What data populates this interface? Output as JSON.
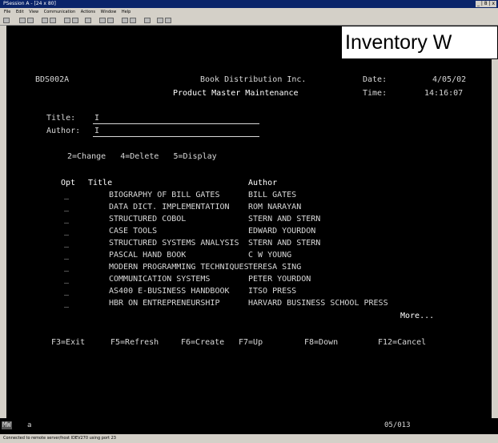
{
  "window": {
    "title": "PSession A - [24 x 80]",
    "controls": "_ | 8 | x"
  },
  "menu": [
    "File",
    "Edit",
    "View",
    "Communication",
    "Actions",
    "Window",
    "Help"
  ],
  "overlay_title": "Inventory W",
  "header": {
    "program_id": "BDS002A",
    "company": "Book Distribution Inc.",
    "screen_title": "Product Master Maintenance",
    "date_label": "Date:",
    "date_value": "4/05/02",
    "time_label": "Time:",
    "time_value": "14:16:07"
  },
  "search": {
    "title_label": "Title:",
    "title_value": "I",
    "author_label": "Author:",
    "author_value": "I"
  },
  "options_line": "2=Change   4=Delete   5=Display",
  "columns": {
    "opt": "Opt",
    "title": "Title",
    "author": "Author"
  },
  "rows": [
    {
      "opt": "_",
      "title": "BIOGRAPHY OF BILL GATES",
      "author": "BILL GATES"
    },
    {
      "opt": "_",
      "title": "DATA DICT. IMPLEMENTATION",
      "author": "ROM NARAYAN"
    },
    {
      "opt": "_",
      "title": "STRUCTURED COBOL",
      "author": "STERN AND STERN"
    },
    {
      "opt": "_",
      "title": "CASE TOOLS",
      "author": "EDWARD YOURDON"
    },
    {
      "opt": "_",
      "title": "STRUCTURED SYSTEMS ANALYSIS",
      "author": "STERN AND STERN"
    },
    {
      "opt": "_",
      "title": "PASCAL HAND BOOK",
      "author": "C W YOUNG"
    },
    {
      "opt": "_",
      "title": "MODERN PROGRAMMING TECHNIQUES",
      "author": "TERESA SING"
    },
    {
      "opt": "_",
      "title": "COMMUNICATION SYSTEMS",
      "author": "PETER YOURDON"
    },
    {
      "opt": "_",
      "title": "AS400 E-BUSINESS HANDBOOK",
      "author": "ITSO PRESS"
    },
    {
      "opt": "_",
      "title": "HBR ON ENTREPRENEURSHIP",
      "author": "HARVARD BUSINESS SCHOOL PRESS"
    }
  ],
  "more": "More...",
  "fkeys": {
    "f3": "F3=Exit",
    "f5": "F5=Refresh",
    "f6": "F6=Create",
    "f7": "F7=Up",
    "f8": "F8=Down",
    "f12": "F12=Cancel"
  },
  "status": {
    "indicator": "MW",
    "field": "a",
    "cursor_pos": "05/013"
  },
  "bottom_status": "Connected to remote server/host IDEV270 using port 23"
}
